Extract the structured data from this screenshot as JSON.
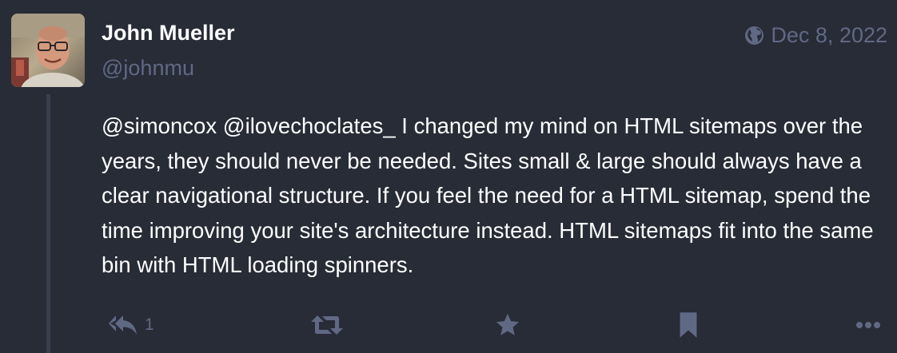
{
  "post": {
    "author": {
      "display_name": "John Mueller",
      "handle": "@johnmu"
    },
    "visibility_icon": "globe-icon",
    "date": "Dec 8, 2022",
    "content": {
      "mentions": [
        "@simoncox",
        "@ilovechoclates_"
      ],
      "text": " I changed my mind on HTML sitemaps over the years, they should never be needed. Sites small & large should always have a clear navigational structure. If you feel the need for a HTML sitemap, spend the time improving your site's architecture instead. HTML sitemaps fit into the same bin with HTML loading spinners."
    },
    "actions": {
      "reply_icon": "reply-all-icon",
      "reply_count": "1",
      "boost_icon": "retweet-icon",
      "favourite_icon": "star-icon",
      "bookmark_icon": "bookmark-icon",
      "more_icon": "ellipsis-icon"
    }
  },
  "colors": {
    "background": "#282c37",
    "text": "#ffffff",
    "muted": "#606984",
    "thread_line": "#3a3f4f"
  }
}
